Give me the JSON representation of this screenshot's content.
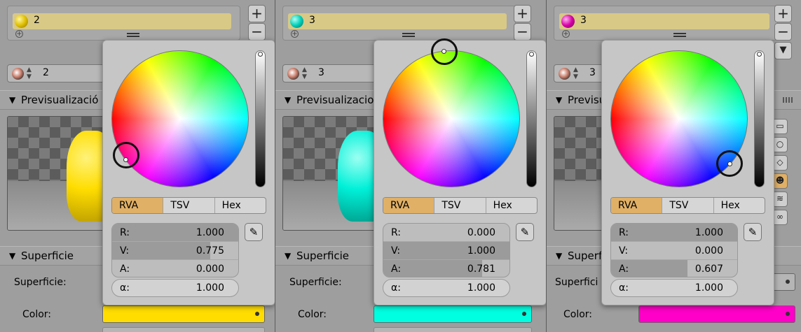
{
  "panels": [
    {
      "slot_name": "2",
      "slot_color": "#ffdd00",
      "material_name": "2",
      "preview_label": "Previsualizació",
      "surface_label": "Superficie",
      "surface_prop_label": "Superficie:",
      "color_label": "Color:",
      "color_value": "#ffdd00",
      "picker": {
        "modes": [
          "RVA",
          "TSV",
          "Hex"
        ],
        "active_mode": "RVA",
        "fields": [
          {
            "name": "R:",
            "value": "1.000",
            "fill": 1.0
          },
          {
            "name": "V:",
            "value": "0.775",
            "fill": 0.775
          },
          {
            "name": "A:",
            "value": "0.000",
            "fill": 0.0
          }
        ],
        "alpha": {
          "name": "α:",
          "value": "1.000"
        }
      }
    },
    {
      "slot_name": "3",
      "slot_color": "#00e5d0",
      "material_name": "3",
      "preview_label": "Previsualizacio",
      "surface_label": "Superficie",
      "surface_prop_label": "Superficie:",
      "color_label": "Color:",
      "color_value": "#00ffe0",
      "picker": {
        "modes": [
          "RVA",
          "TSV",
          "Hex"
        ],
        "active_mode": "RVA",
        "fields": [
          {
            "name": "R:",
            "value": "0.000",
            "fill": 0.0
          },
          {
            "name": "V:",
            "value": "1.000",
            "fill": 1.0
          },
          {
            "name": "A:",
            "value": "0.781",
            "fill": 0.781
          }
        ],
        "alpha": {
          "name": "α:",
          "value": "1.000"
        }
      }
    },
    {
      "slot_name": "3",
      "slot_color": "#e000b0",
      "material_name": "3",
      "preview_label": "Previsu",
      "surface_label": "Superfi",
      "surface_prop_label": "Superfici",
      "color_label": "Color:",
      "color_value": "#ff00c8",
      "picker": {
        "modes": [
          "RVA",
          "TSV",
          "Hex"
        ],
        "active_mode": "RVA",
        "fields": [
          {
            "name": "R:",
            "value": "1.000",
            "fill": 1.0
          },
          {
            "name": "V:",
            "value": "0.000",
            "fill": 0.0
          },
          {
            "name": "A:",
            "value": "0.607",
            "fill": 0.607
          }
        ],
        "alpha": {
          "name": "α:",
          "value": "1.000"
        }
      }
    }
  ],
  "icons": {
    "add": "plus-icon",
    "remove": "minus-icon",
    "dropper": "eyedropper-icon",
    "collapse": "triangle-down-icon"
  }
}
